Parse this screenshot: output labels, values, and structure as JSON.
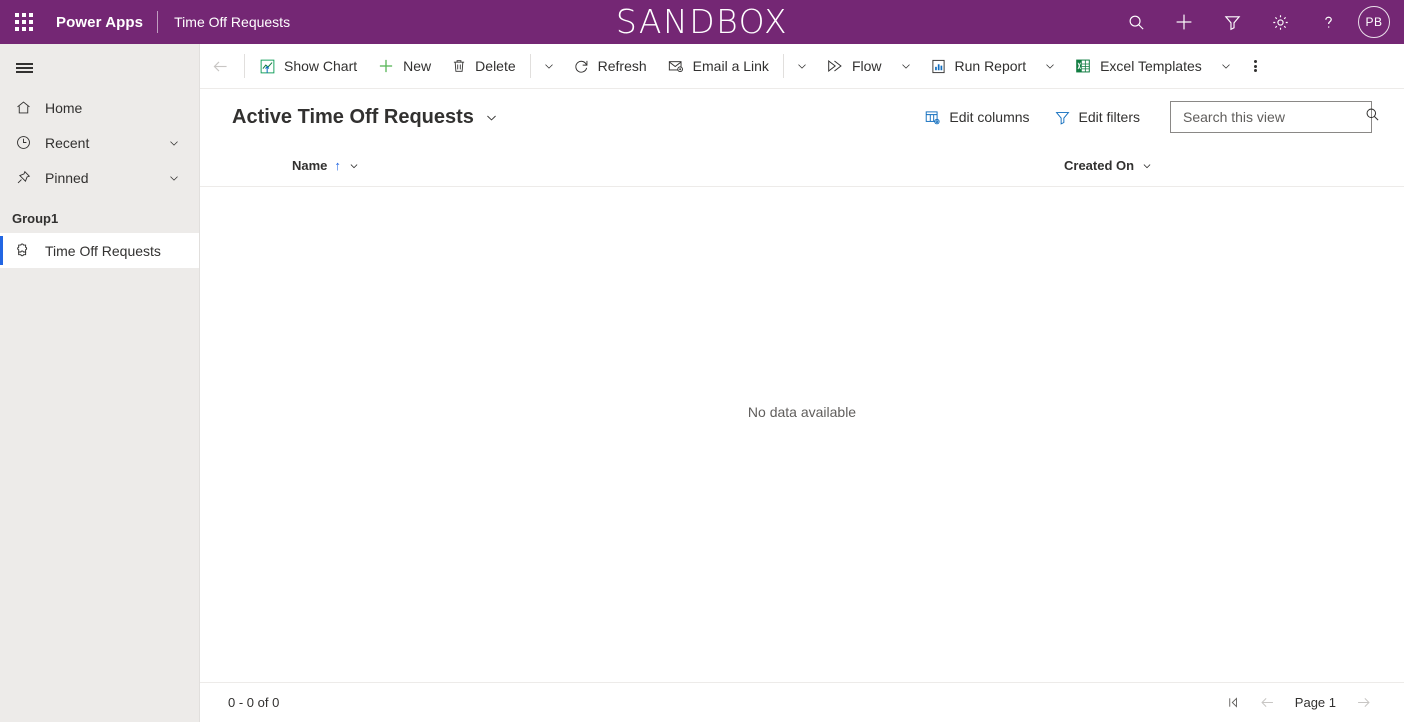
{
  "theme": {
    "header_purple": "#742774",
    "sidebar_gray": "#edebe9",
    "accent_blue": "#2266e3",
    "green": "#5cb85c",
    "teal": "#0f9d58"
  },
  "topbar": {
    "waffle_label": "waffle-icon",
    "brand": "Power Apps",
    "app_name": "Time Off Requests",
    "environment_title": "SANDBOX",
    "icons": [
      {
        "name": "search-icon",
        "label": "Search"
      },
      {
        "name": "plus-icon",
        "label": "New"
      },
      {
        "name": "filter-icon",
        "label": "Filter"
      },
      {
        "name": "gear-icon",
        "label": "Settings"
      },
      {
        "name": "help-icon",
        "label": "Help"
      }
    ],
    "avatar_initials": "PB"
  },
  "sidebar": {
    "hamburger_label": "Site map",
    "items": [
      {
        "label": "Home",
        "icon": "home-icon",
        "expandable": false
      },
      {
        "label": "Recent",
        "icon": "clock-icon",
        "expandable": true
      },
      {
        "label": "Pinned",
        "icon": "pin-icon",
        "expandable": true
      }
    ],
    "group_header": "Group1",
    "entity": {
      "label": "Time Off Requests",
      "icon": "puzzle-icon",
      "selected": true
    }
  },
  "commandbar": {
    "back_label": "Back",
    "buttons": [
      {
        "label": "Show Chart",
        "icon": "show-chart-icon",
        "caret": false
      },
      {
        "label": "New",
        "icon": "plus-green-icon",
        "caret": false
      },
      {
        "label": "Delete",
        "icon": "trash-icon",
        "caret": true
      },
      {
        "label": "Refresh",
        "icon": "refresh-icon",
        "caret": false
      },
      {
        "label": "Email a Link",
        "icon": "email-link-icon",
        "caret": true
      },
      {
        "label": "Flow",
        "icon": "flow-icon",
        "caret": true
      },
      {
        "label": "Run Report",
        "icon": "run-report-icon",
        "caret": true
      },
      {
        "label": "Excel Templates",
        "icon": "excel-icon",
        "caret": true
      }
    ],
    "overflow_label": "More commands"
  },
  "view": {
    "title": "Active Time Off Requests",
    "edit_columns_label": "Edit columns",
    "edit_filters_label": "Edit filters",
    "search_placeholder": "Search this view",
    "search_value": ""
  },
  "grid": {
    "columns": [
      {
        "label": "Name",
        "sorted": true,
        "sort_direction": "asc"
      },
      {
        "label": "Created On",
        "sorted": false
      }
    ],
    "empty_message": "No data available"
  },
  "footer": {
    "record_count": "0 - 0 of 0",
    "page_label": "Page 1",
    "first_page_label": "First page",
    "previous_page_label": "Previous page",
    "next_page_label": "Next page"
  }
}
